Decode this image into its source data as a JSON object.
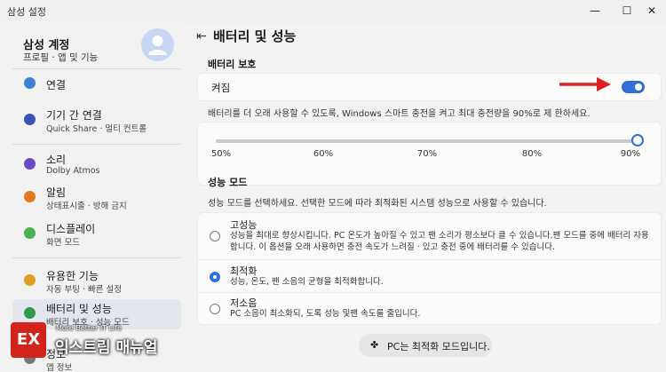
{
  "window": {
    "title": "삼성 설정",
    "minimize": "—",
    "maximize": "☐",
    "close": "✕"
  },
  "account": {
    "title": "삼성 계정",
    "subtitle": "프로필 · 앱 및 기능"
  },
  "sidebar": {
    "items": [
      {
        "label": "연결",
        "sub": "",
        "color": "#3b82d6"
      },
      {
        "label": "기기 간 연결",
        "sub": "Quick Share · 멀티 컨트롤",
        "color": "#3f51b5"
      },
      {
        "label": "소리",
        "sub": "Dolby Atmos",
        "color": "#6a4cc2"
      },
      {
        "label": "알림",
        "sub": "상태표시줄 · 방해 금지",
        "color": "#e07a1f"
      },
      {
        "label": "디스플레이",
        "sub": "화면 모드",
        "color": "#4caf50"
      },
      {
        "label": "유용한 기능",
        "sub": "자동 부팅 · 빠른 설정",
        "color": "#e0a01f"
      },
      {
        "label": "배터리 및 성능",
        "sub": "배터리 보호 · 성능 모드",
        "color": "#2e9a4e"
      },
      {
        "label": "정보",
        "sub": "앱 정보",
        "color": "#777777"
      }
    ]
  },
  "main": {
    "title": "배터리 및 성능",
    "battery_protection": {
      "section_title": "배터리 보호",
      "toggle_label": "켜짐",
      "toggle_on": true,
      "helper": "배터리를 더 오래 사용할 수 있도록, Windows 스마트 충전을 켜고 최대 충전량을 90%로 제 한하세요.",
      "slider_ticks": [
        "50%",
        "60%",
        "70%",
        "80%",
        "90%"
      ],
      "slider_value_percent": 90
    },
    "performance": {
      "section_title": "성능 모드",
      "helper": "성능 모드를 선택하세요. 선택한 모드에 따라 최적화된 시스템 성능으로 사용할 수 있습니다.",
      "modes": [
        {
          "title": "고성능",
          "desc": "성능을 최대로 향상시킵니다. PC 온도가 높아질 수 있고 팬 소리가 평소보다 클 수 있습니다.팬 모드를 중에 배터리 자용합니다. 이 옵션을 오래 사용하면 충전 속도가 느려질 · 있고 충전 중에 배터리를 수 있습니다.",
          "selected": false
        },
        {
          "title": "최적화",
          "desc": "성능, 온도, 팬 소음의 균형을 최적화합니다.",
          "selected": true
        },
        {
          "title": "저소음",
          "desc": "PC 소음이 최소화되, 도록 성능 및팬 속도를 줄입니다.",
          "selected": false
        }
      ]
    },
    "status": {
      "icon": "PC",
      "text": "PC는 최적화 모드입니다."
    }
  },
  "watermark": {
    "logo": "EX",
    "tagline": "More Better IT Life",
    "name": "익스트림 매뉴얼"
  },
  "colors": {
    "accent": "#2f6fd6",
    "arrow": "#e02020",
    "watermark": "#d0241c"
  }
}
